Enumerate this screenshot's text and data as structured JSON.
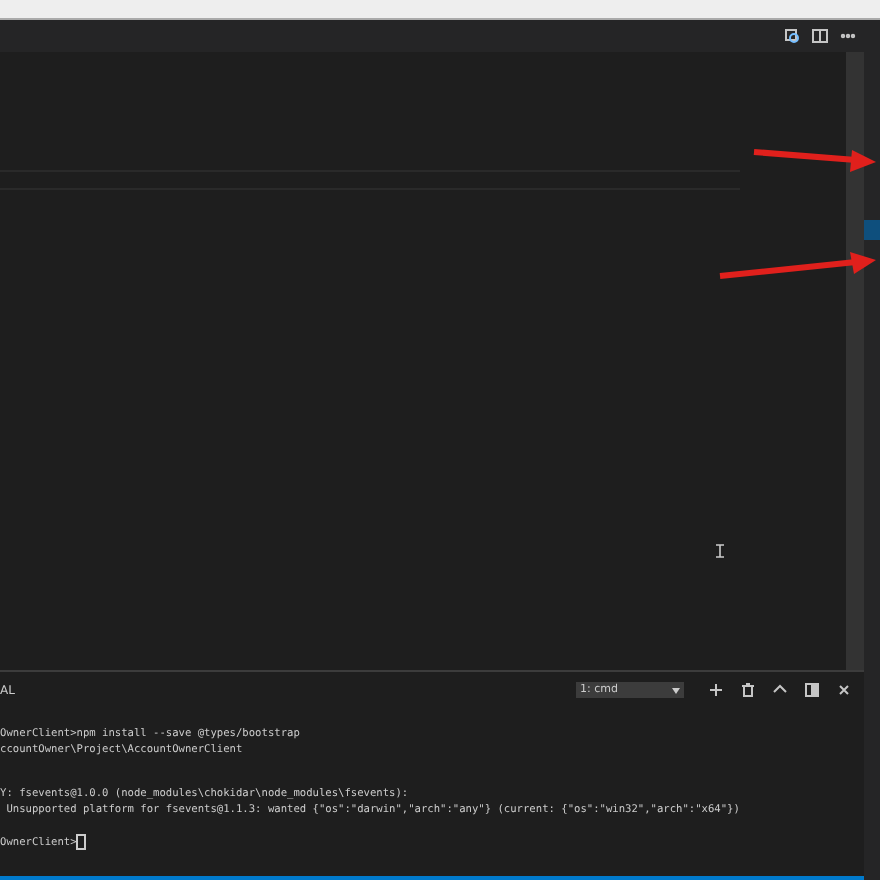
{
  "terminal": {
    "tab_label": "AL",
    "shell_select": "1: cmd",
    "blocks": [
      [
        "OwnerClient>npm install --save @types/bootstrap",
        "ccountOwner\\Project\\AccountOwnerClient"
      ],
      [
        "Y: fsevents@1.0.0 (node_modules\\chokidar\\node_modules\\fsevents):",
        " Unsupported platform for fsevents@1.1.3: wanted {\"os\":\"darwin\",\"arch\":\"any\"} (current: {\"os\":\"win32\",\"arch\":\"x64\"})"
      ]
    ],
    "prompt": "OwnerClient>"
  }
}
